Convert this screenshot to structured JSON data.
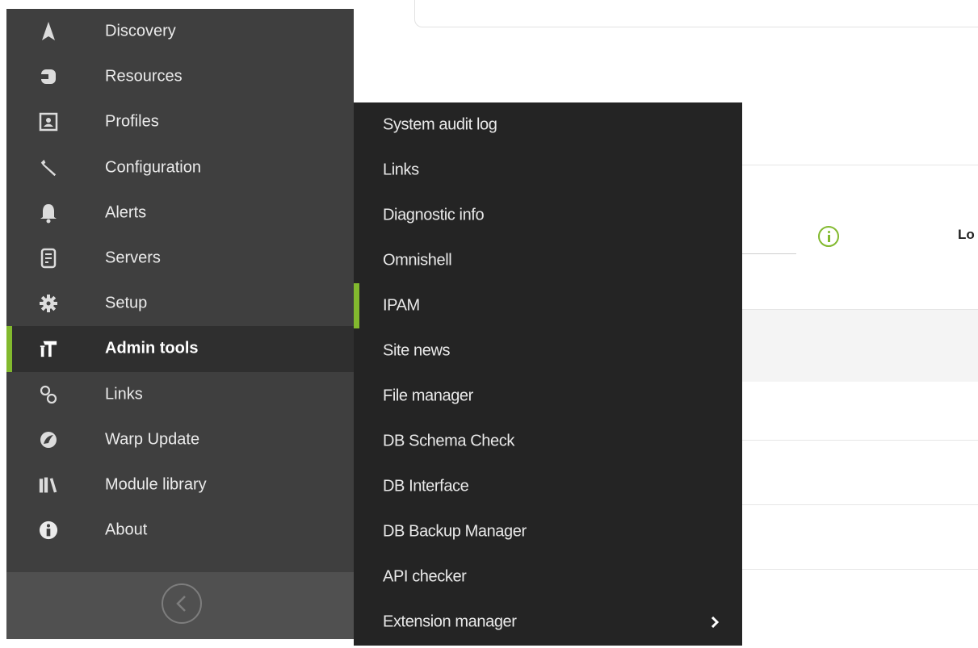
{
  "background": {
    "partial_label": "Lo"
  },
  "sidebar": {
    "items": [
      {
        "label": "Discovery",
        "icon": "rocket-icon"
      },
      {
        "label": "Resources",
        "icon": "resources-icon"
      },
      {
        "label": "Profiles",
        "icon": "profile-card-icon"
      },
      {
        "label": "Configuration",
        "icon": "wrench-icon"
      },
      {
        "label": "Alerts",
        "icon": "bell-icon"
      },
      {
        "label": "Servers",
        "icon": "server-icon"
      },
      {
        "label": "Setup",
        "icon": "gear-icon"
      },
      {
        "label": "Admin tools",
        "icon": "admin-tools-icon",
        "active": true
      },
      {
        "label": "Links",
        "icon": "links-icon"
      },
      {
        "label": "Warp Update",
        "icon": "warp-update-icon"
      },
      {
        "label": "Module library",
        "icon": "library-icon"
      },
      {
        "label": "About",
        "icon": "info-icon"
      }
    ]
  },
  "submenu": {
    "items": [
      {
        "label": "System audit log"
      },
      {
        "label": "Links"
      },
      {
        "label": "Diagnostic info"
      },
      {
        "label": "Omnishell"
      },
      {
        "label": "IPAM",
        "active": true
      },
      {
        "label": "Site news"
      },
      {
        "label": "File manager"
      },
      {
        "label": "DB Schema Check"
      },
      {
        "label": "DB Interface"
      },
      {
        "label": "DB Backup Manager"
      },
      {
        "label": "API checker"
      },
      {
        "label": "Extension manager",
        "has_submenu": true
      }
    ]
  },
  "colors": {
    "accent": "#82b92e",
    "sidebar_bg": "#3f3f3f",
    "submenu_bg": "#242424"
  }
}
